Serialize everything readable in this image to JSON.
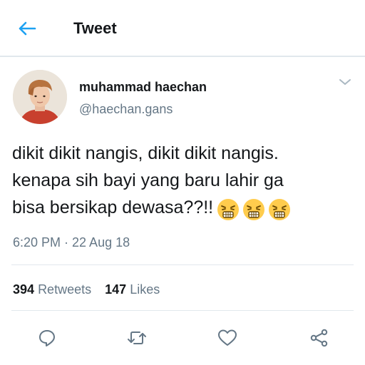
{
  "header": {
    "title": "Tweet",
    "accent_color": "#1da1f2"
  },
  "tweet": {
    "author": {
      "display_name": "muhammad haechan",
      "handle": "@haechan.gans"
    },
    "text_lines": [
      "dikit dikit nangis, dikit dikit nangis.",
      "kenapa sih bayi yang baru lahir ga",
      "bisa bersikap dewasa??!!"
    ],
    "emojis": [
      "persevering-face-emoji",
      "persevering-face-emoji",
      "persevering-face-emoji"
    ],
    "timestamp": "6:20 PM · 22 Aug 18",
    "stats": {
      "retweets_count": "394",
      "retweets_label": "Retweets",
      "likes_count": "147",
      "likes_label": "Likes"
    },
    "actions": [
      "reply-icon",
      "retweet-icon",
      "like-icon",
      "share-icon"
    ]
  },
  "colors": {
    "text_primary": "#14171a",
    "text_secondary": "#657786",
    "divider": "#e1e8ed",
    "icon_gray": "#657786"
  }
}
